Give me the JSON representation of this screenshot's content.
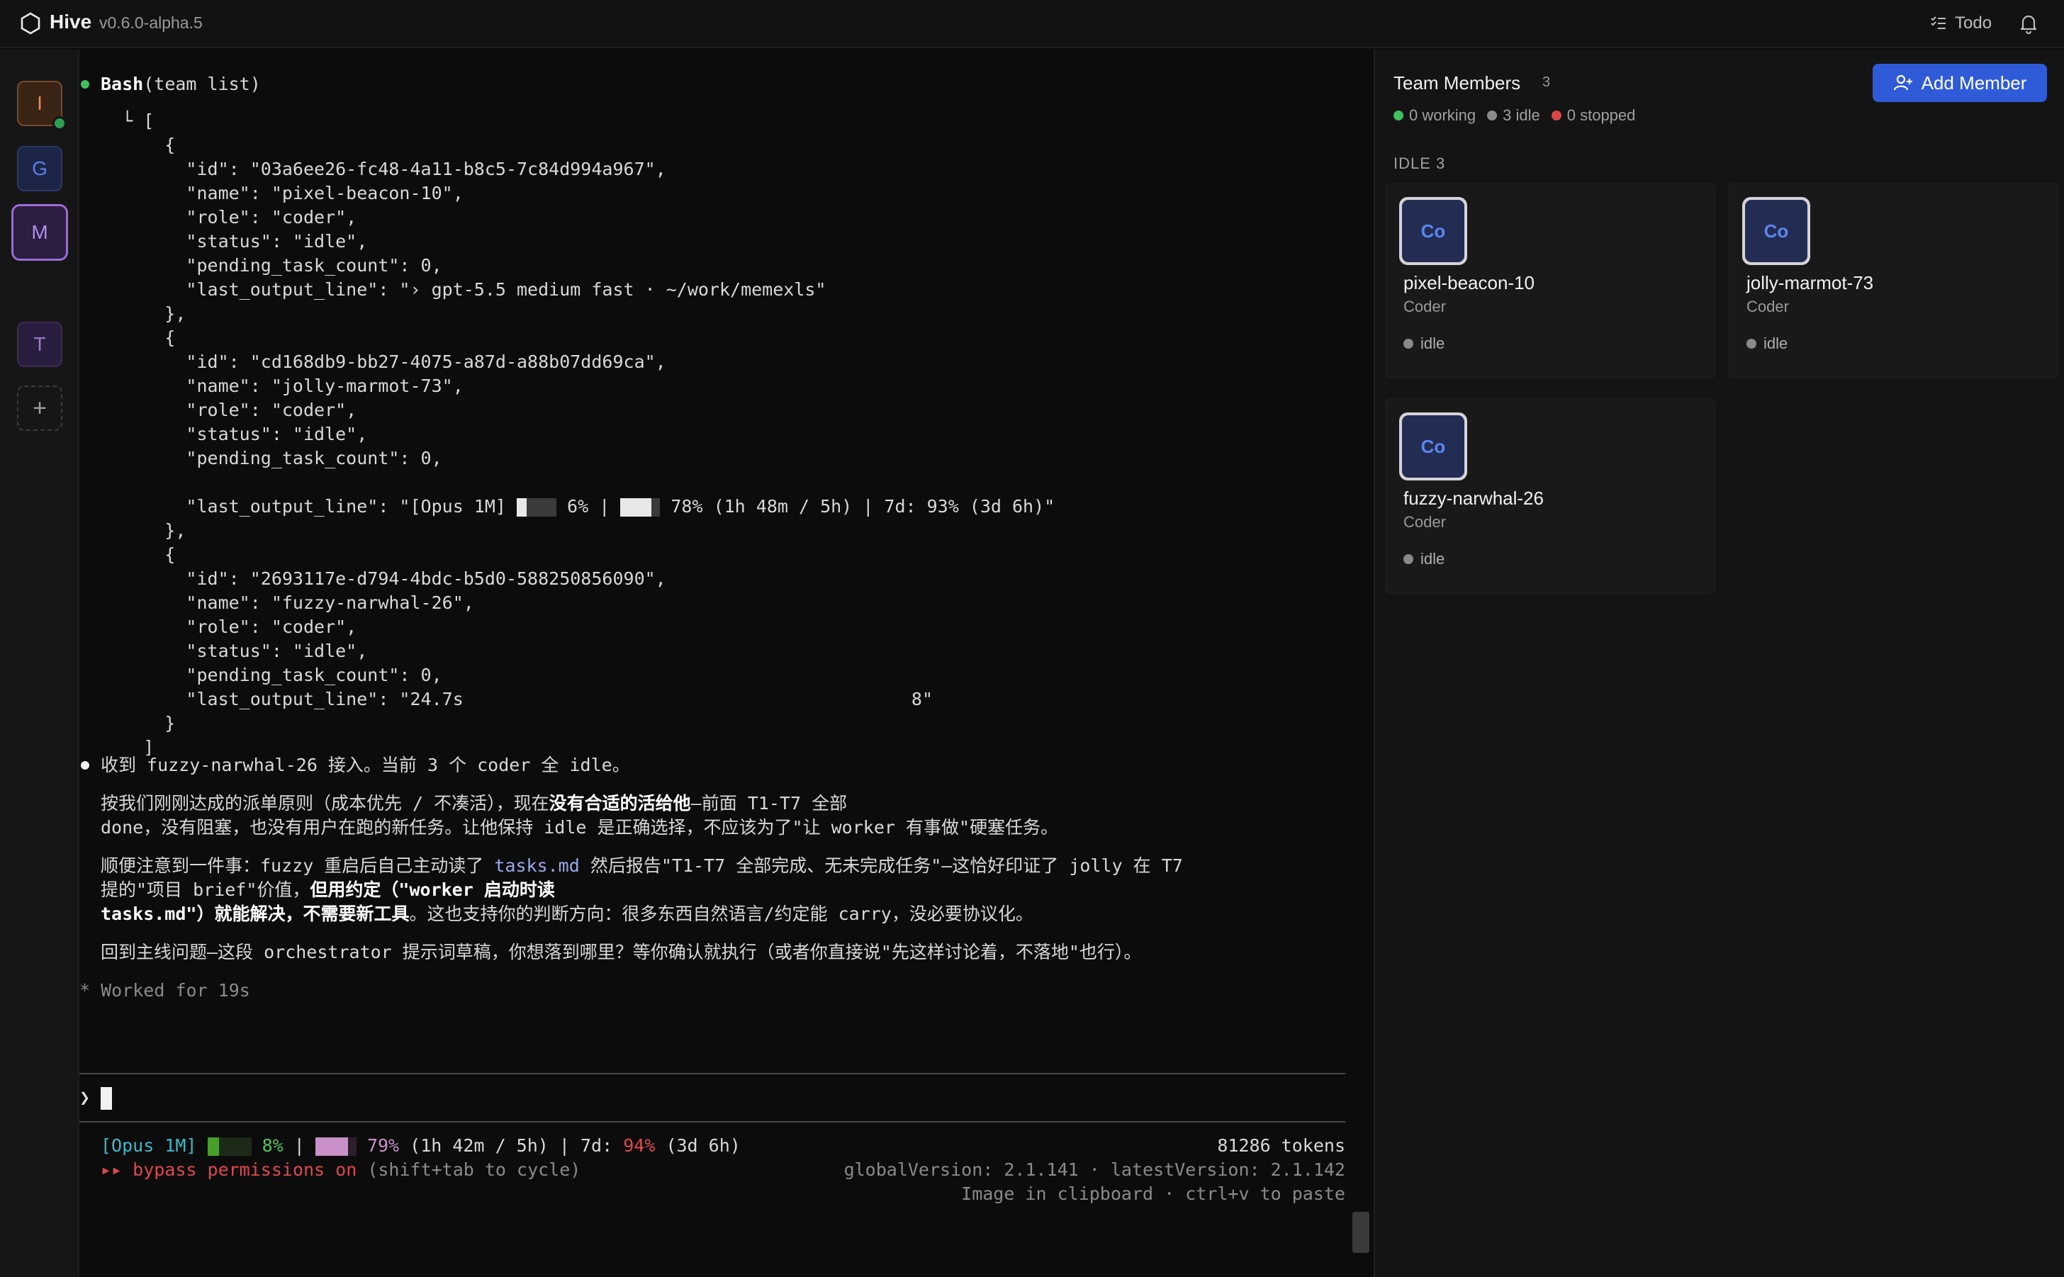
{
  "app": {
    "name": "Hive",
    "version": "v0.6.0-alpha.5",
    "todo_label": "Todo"
  },
  "workspaces": [
    {
      "letter": "I",
      "color": "#f08a4b"
    },
    {
      "letter": "G",
      "color": "#5b7ff0"
    },
    {
      "letter": "M",
      "color": "#b48ae8"
    },
    {
      "letter": "T",
      "color": "#9a7ad0"
    }
  ],
  "add_workspace": "+",
  "terminal": {
    "tool_name": "Bash",
    "tool_args": "(team list)",
    "json_lines": [
      "  └ [",
      "      {",
      "        \"id\": \"03a6ee26-fc48-4a11-b8c5-7c84d994a967\",",
      "        \"name\": \"pixel-beacon-10\",",
      "        \"role\": \"coder\",",
      "        \"status\": \"idle\",",
      "        \"pending_task_count\": 0,",
      "        \"last_output_line\": \"› gpt-5.5 medium fast · ~/work/memexls\"",
      "      },",
      "      {",
      "        \"id\": \"cd168db9-bb27-4075-a87d-a88b07dd69ca\",",
      "        \"name\": \"jolly-marmot-73\",",
      "        \"role\": \"coder\",",
      "        \"status\": \"idle\",",
      "        \"pending_task_count\": 0,"
    ],
    "opus_line_prefix": "        \"last_output_line\": \"[Opus 1M] ",
    "opus_line_mid1": " 6% | ",
    "opus_line_suffix": " 78% (1h 48m / 5h) | 7d: 93% (3d 6h)\"",
    "json_lines2": [
      "      },",
      "      {",
      "        \"id\": \"2693117e-d794-4bdc-b5d0-588250856090\",",
      "        \"name\": \"fuzzy-narwhal-26\",",
      "        \"role\": \"coder\",",
      "        \"status\": \"idle\",",
      "        \"pending_task_count\": 0,",
      "        \"last_output_line\": \"24.7s                                          8\"",
      "      }",
      "    ]"
    ],
    "msg_line1": "收到 fuzzy-narwhal-26 接入。当前 3 个 coder 全 idle。",
    "p1_a": "按我们刚刚达成的派单原则（成本优先 / 不凑活），现在",
    "p1_bold": "没有合适的活给他",
    "p1_b": "—前面 T1-T7 全部",
    "p1_line2": "done，没有阻塞，也没有用户在跑的新任务。让他保持 idle 是正确选择，不应该为了\"让 worker 有事做\"硬塞任务。",
    "p2_a": "顺便注意到一件事：fuzzy 重启后自己主动读了 ",
    "p2_link": "tasks.md",
    "p2_b": " 然后报告\"T1-T7 全部完成、无未完成任务\"—这恰好印证了 jolly 在 T7",
    "p2_line2a": "提的\"项目 brief\"价值，",
    "p2_line2bold": "但用约定（\"worker 启动时读",
    "p2_line3bold": "tasks.md\"）就能解决，不需要新工具",
    "p2_line3b": "。这也支持你的判断方向：很多东西自然语言/约定能 carry，没必要协议化。",
    "p3": "回到主线问题—这段 orchestrator 提示词草稿，你想落到哪里？等你确认就执行（或者你直接说\"先这样讨论着，不落地\"也行）。",
    "worked": "* Worked for 19s",
    "prompt_symbol": "❯",
    "status_model": "[Opus 1M]",
    "status_pct1": "8%",
    "status_sep1": "|",
    "status_pct2": "79%",
    "status_mid": "(1h 42m / 5h) | 7d:",
    "status_pct3": "94%",
    "status_end": "(3d 6h)",
    "tokens": "81286 tokens",
    "bypass_arrows": "▸▸",
    "bypass_text": "bypass permissions on",
    "bypass_hint": "(shift+tab to cycle)",
    "version_line": "globalVersion: 2.1.141 · latestVersion: 2.1.142",
    "clipboard_line": "Image in clipboard · ctrl+v to paste"
  },
  "team": {
    "title": "Team Members",
    "count": "3",
    "working": "0 working",
    "idle": "3 idle",
    "stopped": "0 stopped",
    "add_label": "Add Member",
    "section_label": "IDLE 3",
    "colors": {
      "working": "#3fbf5f",
      "idle": "#8a8a8a",
      "stopped": "#d94848",
      "accent": "#2f5bd8"
    },
    "members": [
      {
        "initials": "Co",
        "name": "pixel-beacon-10",
        "role": "Coder",
        "status": "idle"
      },
      {
        "initials": "Co",
        "name": "jolly-marmot-73",
        "role": "Coder",
        "status": "idle"
      },
      {
        "initials": "Co",
        "name": "fuzzy-narwhal-26",
        "role": "Coder",
        "status": "idle"
      }
    ]
  }
}
